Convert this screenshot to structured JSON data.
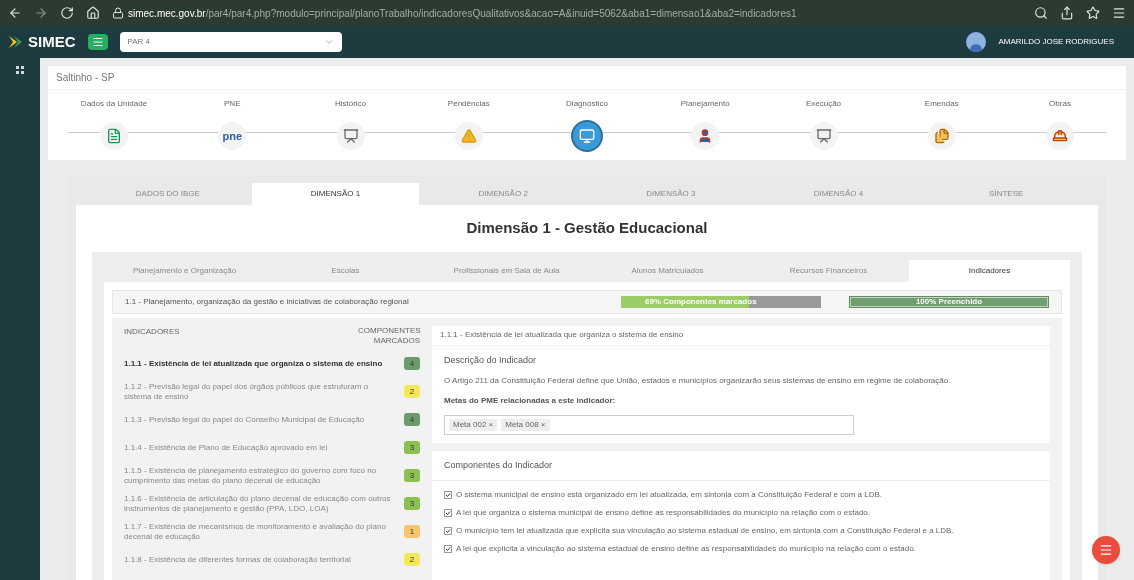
{
  "browser": {
    "url_host": "simec.mec.gov.br",
    "url_path": "/par4/par4.php?modulo=principal/planoTrabalho/indicadoresQualitativos&acao=A&inuid=5062&aba1=dimensao1&aba2=indicadores1"
  },
  "header": {
    "logo": "SIMEC",
    "program_select": "PAR 4",
    "user": "AMARILDO JOSE RODRIGUES"
  },
  "location": "Saltinho - SP",
  "steps": [
    {
      "label": "Dados da Unidade",
      "kind": "document",
      "selected": false
    },
    {
      "label": "PNE",
      "kind": "pne",
      "selected": false
    },
    {
      "label": "Histórico",
      "kind": "board",
      "selected": false
    },
    {
      "label": "Pendências",
      "kind": "warning",
      "selected": false
    },
    {
      "label": "Diagnóstico",
      "kind": "monitor",
      "selected": true
    },
    {
      "label": "Planejamento",
      "kind": "person",
      "selected": false
    },
    {
      "label": "Execução",
      "kind": "board",
      "selected": false
    },
    {
      "label": "Emendas",
      "kind": "files",
      "selected": false
    },
    {
      "label": "Obras",
      "kind": "worker",
      "selected": false
    }
  ],
  "tabs": [
    {
      "label": "DADOS DO IBGE",
      "selected": false
    },
    {
      "label": "DIMENSÃO 1",
      "selected": true
    },
    {
      "label": "DIMENSÃO 2",
      "selected": false
    },
    {
      "label": "DIMENSÃO 3",
      "selected": false
    },
    {
      "label": "DIMENSÃO 4",
      "selected": false
    },
    {
      "label": "SÍNTESE",
      "selected": false
    }
  ],
  "dimension_title": "Dimensão 1 - Gestão Educacional",
  "subtabs": [
    {
      "label": "Planejamento e Organização",
      "selected": false
    },
    {
      "label": "Escolas",
      "selected": false
    },
    {
      "label": "Profissionais em Sala de Aula",
      "selected": false
    },
    {
      "label": "Alunos Matriculados",
      "selected": false
    },
    {
      "label": "Recursos Financeiros",
      "selected": false
    },
    {
      "label": "Indicadores",
      "selected": true
    }
  ],
  "area": {
    "title": "1.1 - Planejamento, organização da gestão e iniciativas de colaboração regional",
    "components_bar": {
      "label": "69% Componentes marcados",
      "level": 0.64
    },
    "filled_bar": {
      "label": "100% Preenchido",
      "level": 1
    }
  },
  "indicators": {
    "column_1": "INDICADORES",
    "column_2": "COMPONENTES MARCADOS",
    "items": [
      {
        "label": "1.1.1 - Existência de lei atualizada que organiza o sistema de ensino",
        "count": "4",
        "color": "#6b9a6b",
        "selected": true
      },
      {
        "label": "1.1.2 - Previsão legal do papel dos órgãos públicos que estruturam o sistema de ensino",
        "count": "2",
        "color": "#f2e85a",
        "selected": false
      },
      {
        "label": "1.1.3 - Previsão legal do papel do Conselho Municipal de Educação",
        "count": "4",
        "color": "#6b9a6b",
        "selected": false
      },
      {
        "label": "1.1.4 - Existência de Plano de Educação aprovado em lei",
        "count": "3",
        "color": "#8cc152",
        "selected": false
      },
      {
        "label": "1.1.5 - Existência de planejamento estratégico do governo com foco no cumprimento das metas do plano decenal de educação",
        "count": "3",
        "color": "#8cc152",
        "selected": false
      },
      {
        "label": "1.1.6 - Existência de articulação do plano decenal de educação com outros instrumentos de planejamento e gestão (PPA, LDO, LOA)",
        "count": "3",
        "color": "#8cc152",
        "selected": false
      },
      {
        "label": "1.1.7 - Existência de mecanismos de monitoramento e avaliação do plano decenal de educação",
        "count": "1",
        "color": "#f7c46c",
        "selected": false
      },
      {
        "label": "1.1.8 - Existência de diferentes formas de colaboração territorial",
        "count": "2",
        "color": "#f2e85a",
        "selected": false
      }
    ]
  },
  "detail": {
    "heading": "1.1.1 - Existência de lei atualizada que organiza o sistema de ensino",
    "description_title": "Descrição do Indicador",
    "description": "O Artigo 211 da Constituição Federal define que União, estados e municípios organizarão seus sistemas de ensino em regime de colaboração.",
    "goals_label": "Metas do PME relacionadas a este indicador:",
    "goals": [
      "Meta 002 ×",
      "Meta 008 ×"
    ],
    "components_title": "Componentes do Indicador",
    "components": [
      {
        "label": "O sistema municipal de ensino está organizado em lei atualizada, em sintonia com a Constituição Federal e com a LDB.",
        "checked": true
      },
      {
        "label": "A lei que organiza o sistema municipal de ensino define as responsabilidades do município na relação com o estado.",
        "checked": true
      },
      {
        "label": "O município tem lei atualizada que explicita sua vinculação ao sistema estadual de ensino, em sintonia com a Constituição Federal e a LDB.",
        "checked": true
      },
      {
        "label": "A lei que explicita a vinculação ao sistema estadual de ensino define as responsabilidades do município na relação com o estado.",
        "checked": true
      }
    ]
  }
}
